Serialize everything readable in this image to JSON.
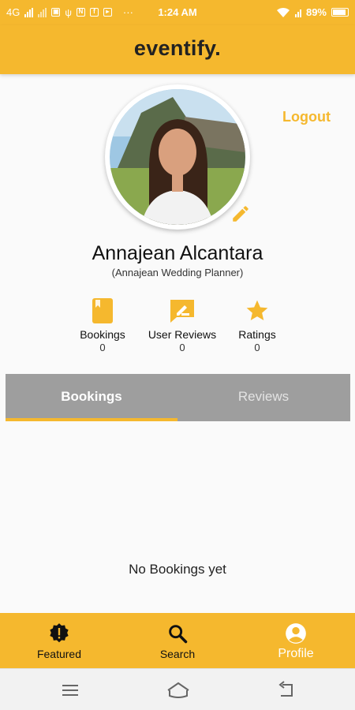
{
  "status_bar": {
    "network": "4G",
    "time": "1:24 AM",
    "battery": "89%",
    "notification_icons": [
      "gallery-icon",
      "usb-icon",
      "notification-icon",
      "facebook-icon",
      "youtube-icon",
      "more-icon"
    ]
  },
  "header": {
    "title": "eventify."
  },
  "profile": {
    "logout_label": "Logout",
    "name": "Annajean Alcantara",
    "subtitle": "(Annajean Wedding Planner)"
  },
  "stats": [
    {
      "label": "Bookings",
      "count": "0",
      "icon": "book-icon"
    },
    {
      "label": "User Reviews",
      "count": "0",
      "icon": "review-icon"
    },
    {
      "label": "Ratings",
      "count": "0",
      "icon": "star-icon"
    }
  ],
  "tabs": [
    {
      "label": "Bookings",
      "active": true
    },
    {
      "label": "Reviews",
      "active": false
    }
  ],
  "empty_state": {
    "message": "No Bookings yet"
  },
  "bottom_nav": [
    {
      "label": "Featured",
      "icon": "featured-badge-icon",
      "active": false
    },
    {
      "label": "Search",
      "icon": "search-icon",
      "active": false
    },
    {
      "label": "Profile",
      "icon": "profile-icon",
      "active": true
    }
  ],
  "colors": {
    "accent": "#f5b82e",
    "tab_bar": "#9e9e9e",
    "background": "#fafafa"
  }
}
